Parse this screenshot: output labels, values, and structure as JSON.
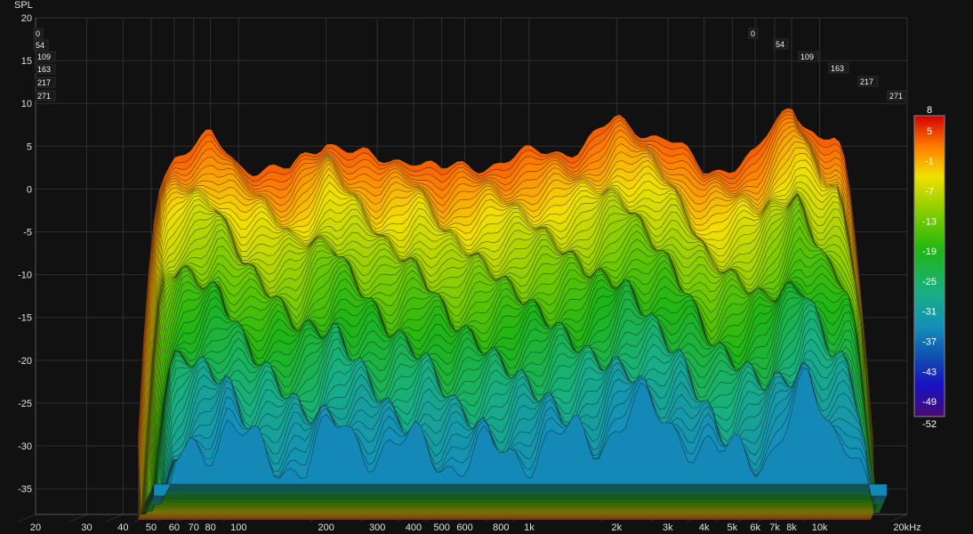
{
  "chart_data": {
    "type": "waterfall",
    "ylabel": "SPL",
    "y_ticks": [
      "20",
      "15",
      "10",
      "5",
      "0",
      "-5",
      "-10",
      "-15",
      "-20",
      "-25",
      "-30",
      "-35"
    ],
    "ylim": [
      -38,
      20
    ],
    "x_scale": "log",
    "xlim": [
      20,
      20000
    ],
    "x_ticks": [
      {
        "label": "20",
        "v": 20
      },
      {
        "label": "30",
        "v": 30
      },
      {
        "label": "40",
        "v": 40
      },
      {
        "label": "50",
        "v": 50
      },
      {
        "label": "60",
        "v": 60
      },
      {
        "label": "70",
        "v": 70
      },
      {
        "label": "80",
        "v": 80
      },
      {
        "label": "100",
        "v": 100
      },
      {
        "label": "200",
        "v": 200
      },
      {
        "label": "300",
        "v": 300
      },
      {
        "label": "400",
        "v": 400
      },
      {
        "label": "500",
        "v": 500
      },
      {
        "label": "600",
        "v": 600
      },
      {
        "label": "800",
        "v": 800
      },
      {
        "label": "1k",
        "v": 1000
      },
      {
        "label": "2k",
        "v": 2000
      },
      {
        "label": "3k",
        "v": 3000
      },
      {
        "label": "4k",
        "v": 4000
      },
      {
        "label": "5k",
        "v": 5000
      },
      {
        "label": "6k",
        "v": 6000
      },
      {
        "label": "7k",
        "v": 7000
      },
      {
        "label": "8k",
        "v": 8000
      },
      {
        "label": "10k",
        "v": 10000
      },
      {
        "label": "20kHz",
        "v": 20000
      }
    ],
    "time_slices": [
      "0",
      "54",
      "109",
      "163",
      "217",
      "271"
    ],
    "slice_count": 60,
    "freq_range_hz": [
      45,
      15000
    ],
    "ridge_spl": {
      "hz": [
        45,
        60,
        80,
        100,
        150,
        200,
        300,
        400,
        500,
        700,
        1000,
        1500,
        2000,
        3000,
        4000,
        5000,
        6000,
        8000,
        10000
      ],
      "spl": [
        -2,
        4,
        6,
        3,
        2,
        6,
        3,
        4,
        2,
        3,
        4,
        5,
        8,
        6,
        2,
        3,
        4,
        10,
        6
      ]
    },
    "colorbar": {
      "labels": [
        "8",
        "5",
        "-1",
        "-7",
        "-13",
        "-19",
        "-25",
        "-31",
        "-37",
        "-43",
        "-49",
        "-52"
      ],
      "values": [
        8,
        5,
        -1,
        -7,
        -13,
        -19,
        -25,
        -31,
        -37,
        -43,
        -49,
        -52
      ],
      "range": [
        -52,
        8
      ],
      "stops": [
        {
          "v": 8,
          "color": "#d10000"
        },
        {
          "v": 2,
          "color": "#ff7a00"
        },
        {
          "v": -4,
          "color": "#f2e000"
        },
        {
          "v": -13,
          "color": "#6cc800"
        },
        {
          "v": -19,
          "color": "#1fb515"
        },
        {
          "v": -27,
          "color": "#18b080"
        },
        {
          "v": -34,
          "color": "#1590b8"
        },
        {
          "v": -40,
          "color": "#1050b0"
        },
        {
          "v": -46,
          "color": "#1a10c0"
        },
        {
          "v": -52,
          "color": "#4a0a70"
        }
      ]
    }
  }
}
